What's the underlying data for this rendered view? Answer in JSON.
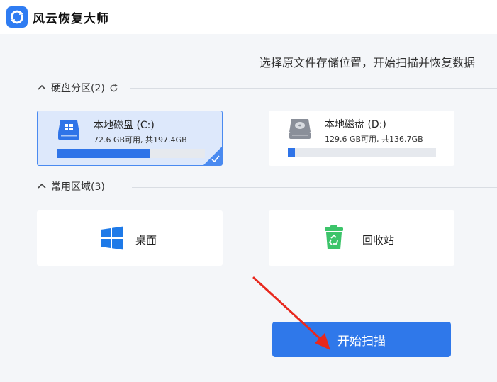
{
  "app": {
    "title": "风云恢复大师"
  },
  "subtitle": "选择原文件存储位置，开始扫描并恢复数据",
  "sections": {
    "disk": {
      "label": "硬盘分区(2)"
    },
    "common": {
      "label": "常用区域(3)"
    }
  },
  "drives": [
    {
      "name": "本地磁盘 (C:)",
      "size_text": "72.6 GB可用, 共197.4GB",
      "used_fraction": 0.63,
      "selected": true
    },
    {
      "name": "本地磁盘 (D:)",
      "size_text": "129.6 GB可用, 共136.7GB",
      "used_fraction": 0.05,
      "selected": false
    }
  ],
  "locations": [
    {
      "label": "桌面",
      "icon": "windows-icon"
    },
    {
      "label": "回收站",
      "icon": "recycle-bin-icon"
    }
  ],
  "scan_button": {
    "label": "开始扫描"
  },
  "colors": {
    "accent": "#2f78ea",
    "selected_bg": "#dde8fb",
    "recycle": "#3cc46a"
  }
}
